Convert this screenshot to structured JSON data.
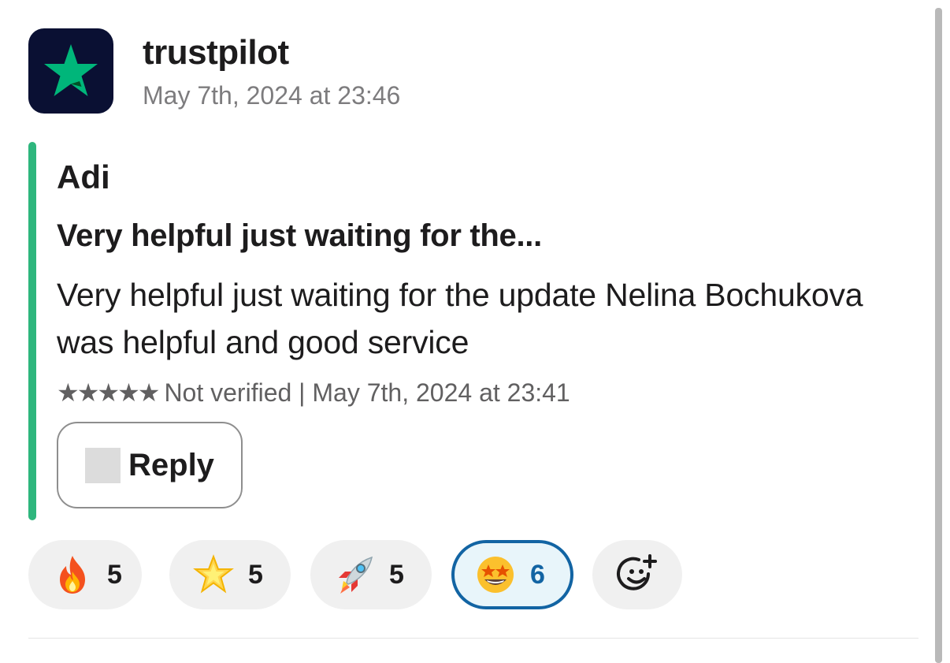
{
  "message": {
    "sender": "trustpilot",
    "timestamp": "May 7th, 2024 at 23:46",
    "avatar_icon": "trustpilot-star-icon",
    "accent_color": "#2eb67d"
  },
  "review": {
    "author": "Adi",
    "title": "Very helpful just waiting for the...",
    "body": "Very helpful just waiting for the update Nelina Bochukova was helpful and good service",
    "rating": 5,
    "stars": "★★★★★",
    "meta": "Not verified | May 7th, 2024 at 23:41",
    "reply_label": "Reply"
  },
  "reactions": [
    {
      "icon": "fire-emoji",
      "count": "5",
      "selected": false
    },
    {
      "icon": "star-emoji",
      "count": "5",
      "selected": false
    },
    {
      "icon": "rocket-emoji",
      "count": "5",
      "selected": false
    },
    {
      "icon": "star-struck-emoji",
      "count": "6",
      "selected": true
    }
  ],
  "add_reaction_icon": "add-reaction-icon"
}
